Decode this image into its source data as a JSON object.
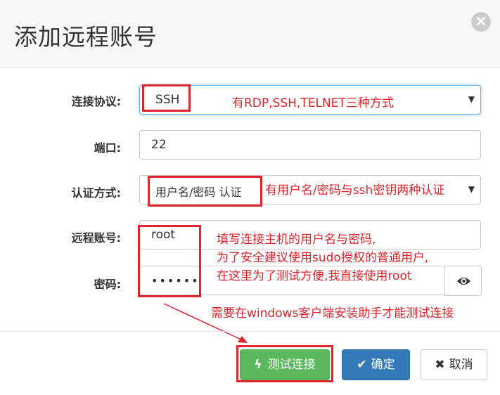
{
  "dialog": {
    "title": "添加远程账号",
    "close_icon": "×"
  },
  "form": {
    "protocol_label": "连接协议:",
    "protocol_value": "SSH",
    "port_label": "端口:",
    "port_value": "22",
    "auth_label": "认证方式:",
    "auth_value": "用户名/密码 认证",
    "account_label": "远程账号:",
    "account_value": "root",
    "password_label": "密码:",
    "password_value": "••••••"
  },
  "annotations": {
    "protocol_note": "有RDP,SSH,TELNET三种方式",
    "auth_note": "有用户名/密码与ssh密钥两种认证",
    "account_note_1": "填写连接主机的用户名与密码,",
    "account_note_2": "为了安全建议使用sudo授权的普通用户,",
    "account_note_3": "在这里为了测试方便,我直接使用root",
    "client_note": "需要在windows客户端安装助手才能测试连接"
  },
  "buttons": {
    "test_label": "测试连接",
    "confirm_label": "确定",
    "cancel_label": "取消"
  },
  "colors": {
    "annotation_red": "#e0242c",
    "success": "#5cb85c",
    "primary": "#337ab7"
  }
}
